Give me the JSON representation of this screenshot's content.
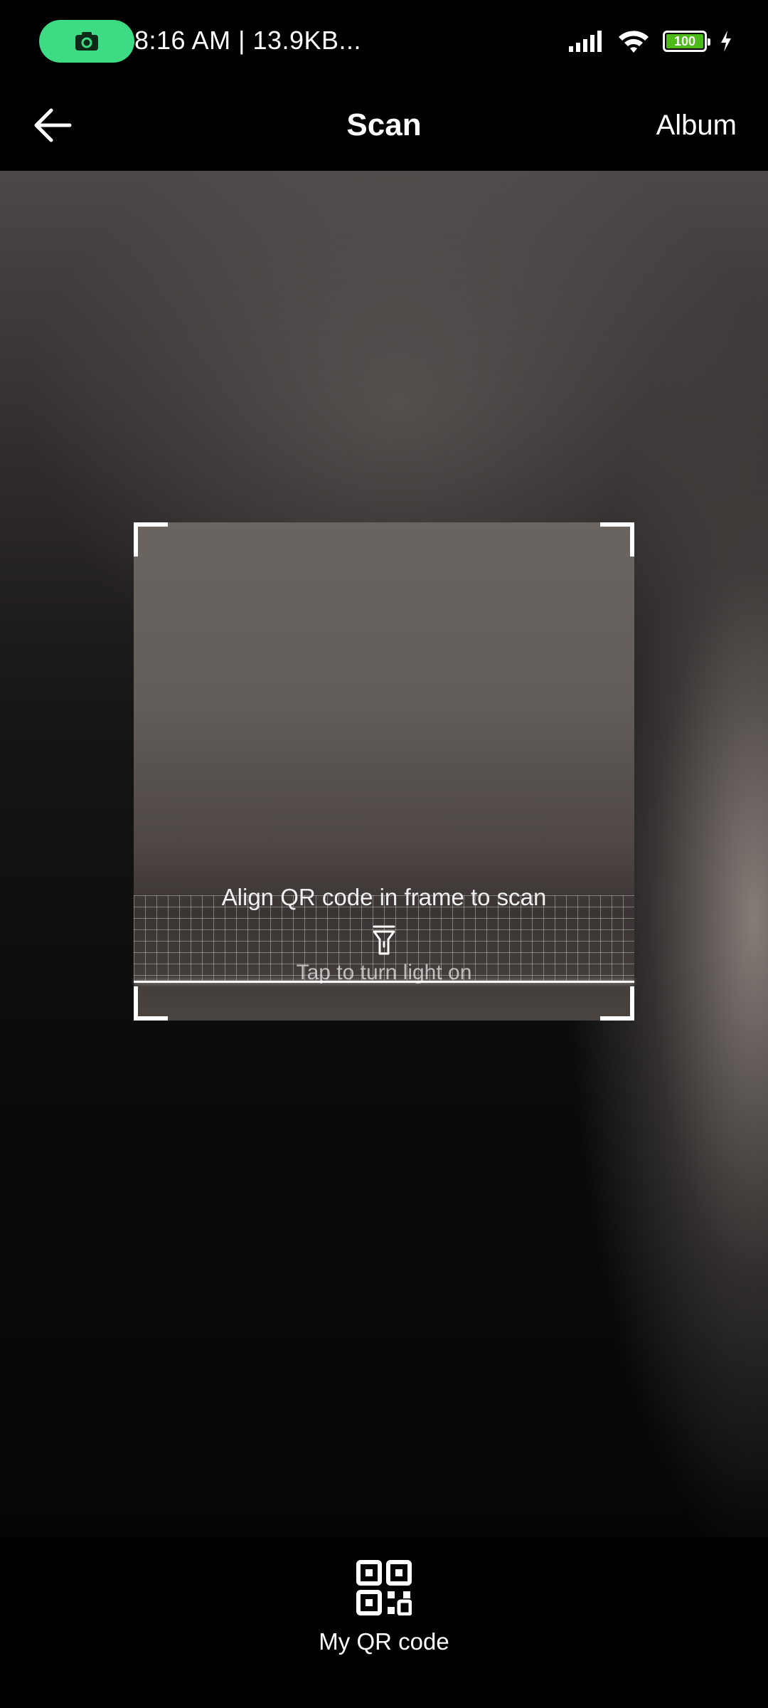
{
  "status_bar": {
    "time": "8:16 AM | 13.9KB...",
    "battery": "100",
    "icons": [
      "camera-record-icon",
      "signal-icon",
      "wifi-icon",
      "battery-icon",
      "charging-icon"
    ],
    "pill_color": "#3ddc84",
    "battery_color": "#4cbb17"
  },
  "header": {
    "back_icon": "back-arrow-icon",
    "title": "Scan",
    "album_label": "Album"
  },
  "scanner": {
    "flashlight_icon": "flashlight-icon",
    "light_label": "Tap to turn light on",
    "hint": "Align QR code in frame to scan"
  },
  "footer": {
    "qr_icon": "qr-code-icon",
    "my_qr_label": "My QR code"
  }
}
